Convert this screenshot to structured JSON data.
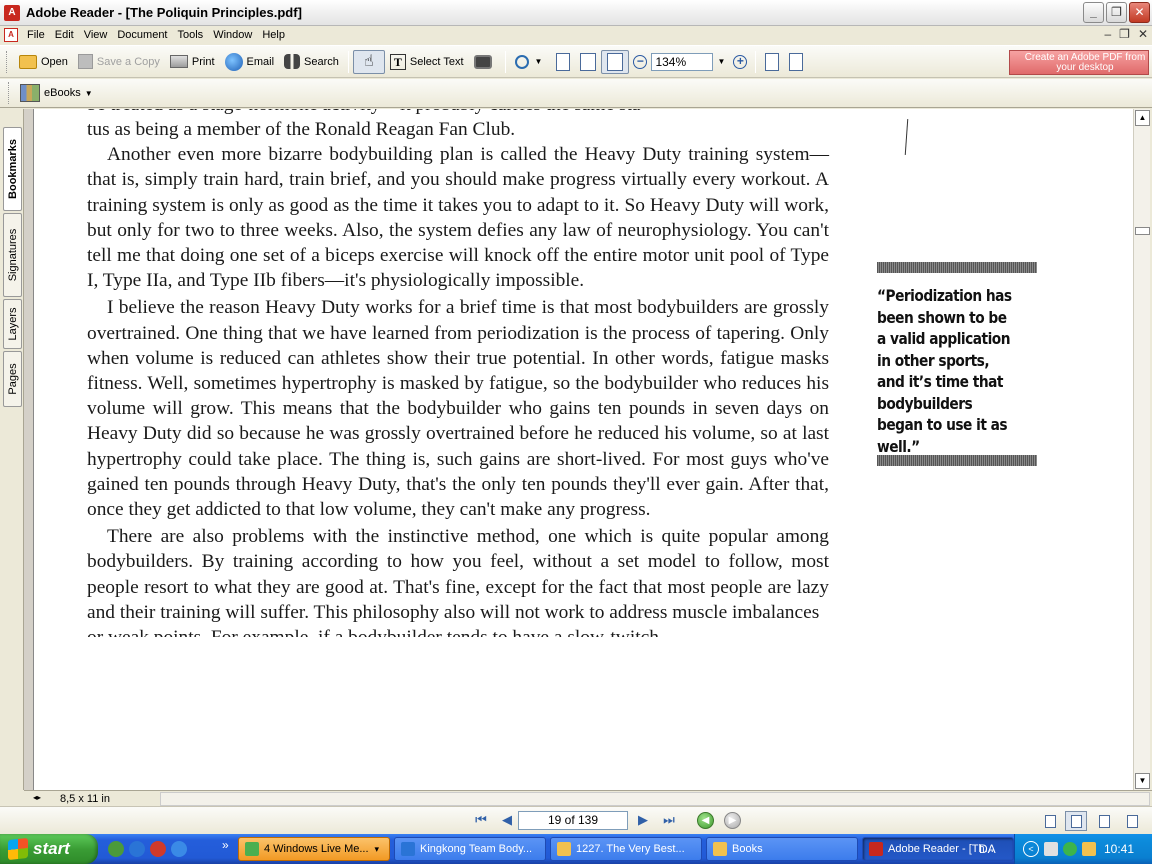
{
  "window": {
    "app_icon_text": "A",
    "title": "Adobe Reader - [The Poliquin Principles.pdf]",
    "buttons": {
      "minimize": "_",
      "restore": "❐",
      "close": "✕"
    }
  },
  "menubar": {
    "doc_icon_text": "A",
    "items": [
      "File",
      "Edit",
      "View",
      "Document",
      "Tools",
      "Window",
      "Help"
    ],
    "mdi": {
      "minimize": "–",
      "restore": "❐",
      "close": "✕"
    }
  },
  "toolbar": {
    "open": "Open",
    "save_copy": "Save a Copy",
    "print": "Print",
    "email": "Email",
    "search": "Search",
    "hand_glyph": "☝",
    "select_text": "Select Text",
    "text_glyph": "T",
    "zoom_out": "−",
    "zoom_in": "+",
    "zoom": "134%",
    "create_pdf": "Create an Adobe PDF from your desktop"
  },
  "ebooks": {
    "label": "eBooks"
  },
  "sidetabs": [
    "Bookmarks",
    "Signatures",
    "Layers",
    "Pages"
  ],
  "document": {
    "top_cut_line": "be treated as a stage-hormone activity—it probably carries the same sta-",
    "paragraphs": [
      "tus as being a member of the Ronald Reagan Fan Club.",
      "Another even more bizarre bodybuilding plan is called the Heavy Duty training system—that is, simply train hard, train brief, and you should make progress virtually every workout. A training system is only as good as the time it takes you to adapt to it. So Heavy Duty will work, but only for two to three weeks. Also, the system defies any law of neurophysiology. You can't tell me that doing one set of a biceps exercise will knock off the entire motor unit pool of Type I, Type IIa, and Type IIb fibers—it's physiologically impossible.",
      "I believe the reason Heavy Duty works for a brief time is that most bodybuilders are grossly overtrained. One thing that we have learned from periodization is the process of tapering. Only when volume is reduced can athletes show their true potential. In other words, fatigue masks fitness. Well, sometimes hypertrophy is masked by fatigue, so the bodybuilder who reduces his volume will grow. This means that the bodybuilder who gains ten pounds in seven days on Heavy Duty did so because he was grossly overtrained before he reduced his volume, so at last hypertrophy could take place. The thing is, such gains are short-lived. For most guys who've gained ten pounds through Heavy Duty, that's the only ten pounds they'll ever gain. After that, once they get addicted to that low volume, they can't make any progress.",
      "There are also problems with the instinctive method, one which is quite popular among bodybuilders. By training according to how you feel, without a set model to follow, most people resort to what they are good at. That's fine, except for the fact that most people are lazy and their training will suffer. This philosophy also will not work to address muscle imbalances"
    ],
    "bottom_cut_line": "or weak points. For example, if a bodybuilder tends to have a slow-twitch",
    "pull_quote": "“Periodization has been shown to be a valid application in other sports, and it’s time that bodybuilders began to use it as well.”"
  },
  "scrollbar": {
    "up": "▲",
    "down": "▼"
  },
  "statusbar": {
    "page_size": "8,5 x 11 in",
    "toggle": "◂▸"
  },
  "navigation": {
    "first": "⏮",
    "prev": "◀",
    "next": "▶",
    "last": "⏭",
    "page_display": "19 of 139",
    "back": "◀",
    "forward": "▶"
  },
  "taskbar": {
    "start": "start",
    "overflow": "»",
    "tasks": [
      {
        "label": "4 Windows Live Me...",
        "has_menu": true,
        "menu_glyph": "▾"
      },
      {
        "label": "Kingkong Team Body..."
      },
      {
        "label": "1227. The Very Best..."
      },
      {
        "label": "Books"
      },
      {
        "label": "Adobe Reader - [Th..."
      }
    ],
    "language": "DA",
    "tray_collapse": "<",
    "clock": "10:41"
  }
}
